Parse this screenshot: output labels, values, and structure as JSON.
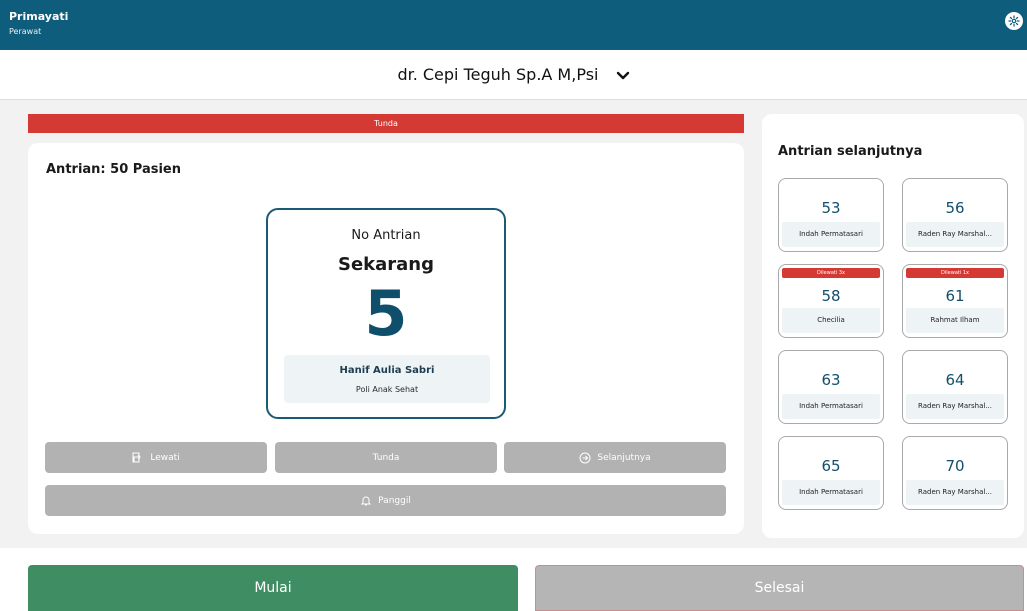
{
  "user": {
    "name": "Primayati",
    "role": "Perawat"
  },
  "doctor": {
    "name": "dr. Cepi Teguh Sp.A M,Psi"
  },
  "status_banner": "Tunda",
  "queue": {
    "count_label": "Antrian: 50 Pasien",
    "current": {
      "label_top": "No Antrian",
      "label_main": "Sekarang",
      "number": "5",
      "patient_name": "Hanif Aulia Sabri",
      "poli": "Poli Anak Sehat"
    }
  },
  "actions": {
    "lewati": "Lewati",
    "tunda": "Tunda",
    "selanjutnya": "Selanjutnya",
    "panggil": "Panggil"
  },
  "next_queue": {
    "title": "Antrian selanjutnya",
    "items": [
      {
        "number": "53",
        "name": "Indah Permatasari",
        "skip": ""
      },
      {
        "number": "56",
        "name": "Raden Ray Marshal...",
        "skip": ""
      },
      {
        "number": "58",
        "name": "Checilia",
        "skip": "Dilewati 3x"
      },
      {
        "number": "61",
        "name": "Rahmat Ilham",
        "skip": "Dilewati 1x"
      },
      {
        "number": "63",
        "name": "Indah Permatasari",
        "skip": ""
      },
      {
        "number": "64",
        "name": "Raden Ray Marshal...",
        "skip": ""
      },
      {
        "number": "65",
        "name": "Indah Permatasari",
        "skip": ""
      },
      {
        "number": "70",
        "name": "Raden Ray Marshal...",
        "skip": ""
      }
    ]
  },
  "bottom": {
    "start": "Mulai",
    "finish": "Selesai"
  },
  "colors": {
    "header": "#0f5d7d",
    "accent_number": "#0f4f6c",
    "danger": "#d43a33",
    "start": "#3f8d62",
    "disabled": "#b2b2b2"
  }
}
